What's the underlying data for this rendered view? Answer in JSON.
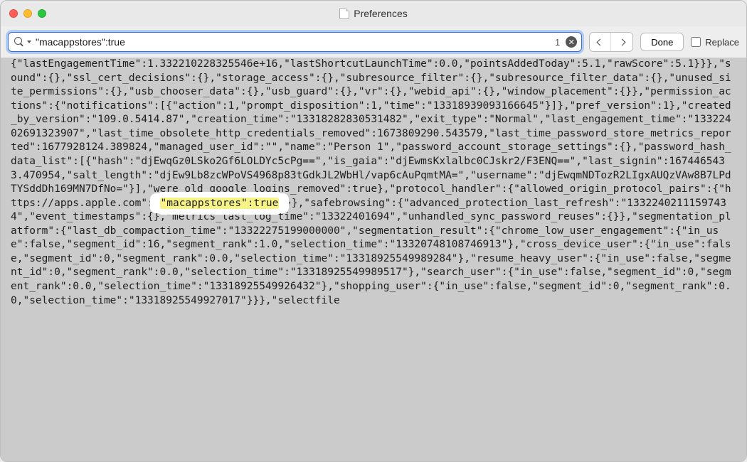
{
  "window": {
    "title": "Preferences"
  },
  "find": {
    "query": "\"macappstores\":true",
    "count": "1",
    "done_label": "Done",
    "replace_label": "Replace"
  },
  "text": {
    "pre": "{\"lastEngagementTime\":1.332210228325546e+16,\"lastShortcutLaunchTime\":0.0,\"pointsAddedToday\":5.1,\"rawScore\":5.1}}},\"sound\":{},\"ssl_cert_decisions\":{},\"storage_access\":{},\"subresource_filter\":{},\"subresource_filter_data\":{},\"unused_site_permissions\":{},\"usb_chooser_data\":{},\"usb_guard\":{},\"vr\":{},\"webid_api\":{},\"window_placement\":{}},\"permission_actions\":{\"notifications\":[{\"action\":1,\"prompt_disposition\":1,\"time\":\"13318939093166645\"}]},\"pref_version\":1},\"created_by_version\":\"109.0.5414.87\",\"creation_time\":\"13318282830531482\",\"exit_type\":\"Normal\",\"last_engagement_time\":\"13322402691323907\",\"last_time_obsolete_http_credentials_removed\":1673809290.543579,\"last_time_password_store_metrics_reported\":1677928124.389824,\"managed_user_id\":\"\",\"name\":\"Person 1\",\"password_account_storage_settings\":{},\"password_hash_data_list\":[{\"hash\":\"djEwqGz0LSko2Gf6LOLDYc5cPg==\",\"is_gaia\":\"djEwmsKxlalbc0CJskr2/F3ENQ==\",\"last_signin\":1674465433.470954,\"salt_length\":\"djEw9Lb8zcWPoVS4968p83tGdkJL2WbHl/vap6cAuPqmtMA=\",\"username\":\"djEwqmNDTozR2LIgxAUQzVAw8B7LPdTYSddDh169MN7DfNo=\"}],\"were_old_google_logins_removed\":true},\"protocol_handler\":{\"allowed_origin_protocol_pairs\":{\"https://apps.apple.com\":{",
    "match": "\"macappstores\":true",
    "post": "}}},\"safebrowsing\":{\"advanced_protection_last_refresh\":\"13322402111597434\",\"event_timestamps\":{},\"metrics_last_log_time\":\"13322401694\",\"unhandled_sync_password_reuses\":{}},\"segmentation_platform\":{\"last_db_compaction_time\":\"13322275199000000\",\"segmentation_result\":{\"chrome_low_user_engagement\":{\"in_use\":false,\"segment_id\":16,\"segment_rank\":1.0,\"selection_time\":\"13320748108746913\"},\"cross_device_user\":{\"in_use\":false,\"segment_id\":0,\"segment_rank\":0.0,\"selection_time\":\"13318925549989284\"},\"resume_heavy_user\":{\"in_use\":false,\"segment_id\":0,\"segment_rank\":0.0,\"selection_time\":\"13318925549989517\"},\"search_user\":{\"in_use\":false,\"segment_id\":0,\"segment_rank\":0.0,\"selection_time\":\"13318925549926432\"},\"shopping_user\":{\"in_use\":false,\"segment_id\":0,\"segment_rank\":0.0,\"selection_time\":\"13318925549927017\"}}},\"selectfile"
  }
}
